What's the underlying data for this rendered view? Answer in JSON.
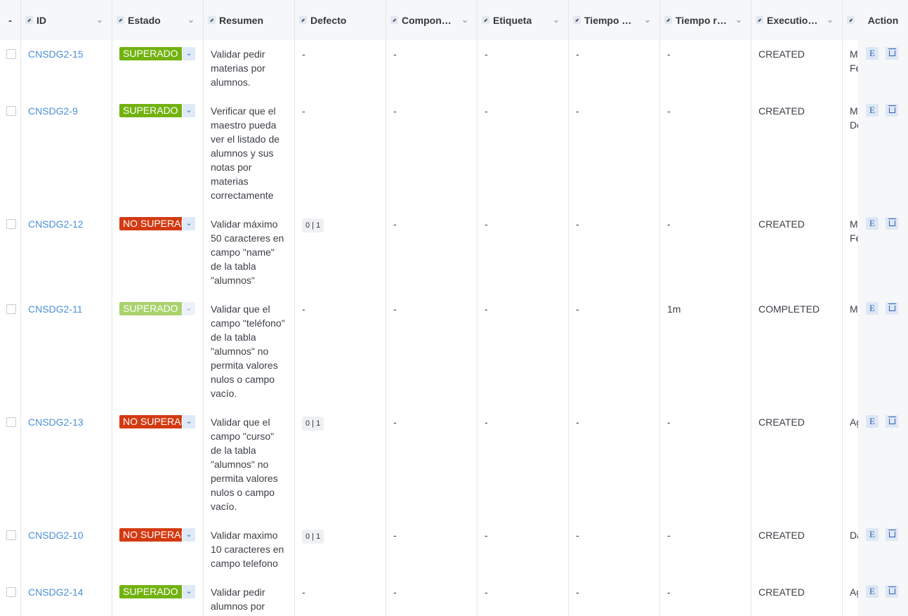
{
  "headers": {
    "select": "-",
    "id": "ID",
    "estado": "Estado",
    "resumen": "Resumen",
    "defecto": "Defecto",
    "componente": "Componente",
    "etiqueta": "Etiqueta",
    "tiempo_estimado": "Tiempo estimado",
    "tiempo_real": "Tiempo real",
    "execution": "Execution status",
    "extra": "",
    "action": "Action"
  },
  "colors": {
    "superado": "#72b20f",
    "superado_faded": "#a9d26c",
    "no_superado": "#d33a12",
    "link": "#4a90d9"
  },
  "rows": [
    {
      "id": "CNSDG2-15",
      "estado": "SUPERADO",
      "estado_kind": "superado",
      "resumen": "Validar pedir materias por alumnos.",
      "defecto": "-",
      "componente": "-",
      "etiqueta": "-",
      "tiempo_estimado": "-",
      "tiempo_real": "-",
      "execution": "CREATED",
      "extra": "M\nFe"
    },
    {
      "id": "CNSDG2-9",
      "estado": "SUPERADO",
      "estado_kind": "superado",
      "resumen": "Verificar que el maestro pueda ver el listado de alumnos y sus notas por materias correctamente",
      "defecto": "-",
      "componente": "-",
      "etiqueta": "-",
      "tiempo_estimado": "-",
      "tiempo_real": "-",
      "execution": "CREATED",
      "extra": "M\nDo"
    },
    {
      "id": "CNSDG2-12",
      "estado": "NO SUPERADO",
      "estado_kind": "no_superado",
      "resumen": "Validar máximo 50 caracteres en campo \"name\" de la tabla \"alumnos\"",
      "defecto": "0 | 1",
      "componente": "-",
      "etiqueta": "-",
      "tiempo_estimado": "-",
      "tiempo_real": "-",
      "execution": "CREATED",
      "extra": "M\nFe"
    },
    {
      "id": "CNSDG2-11",
      "estado": "SUPERADO",
      "estado_kind": "superado_faded",
      "resumen": "Validar que el campo \"teléfono\" de la tabla \"alumnos\" no permita valores nulos o campo vacío.",
      "defecto": "-",
      "componente": "-",
      "etiqueta": "-",
      "tiempo_estimado": "-",
      "tiempo_real": "1m",
      "execution": "COMPLETED",
      "extra": "M"
    },
    {
      "id": "CNSDG2-13",
      "estado": "NO SUPERADO",
      "estado_kind": "no_superado",
      "resumen": "Validar que el campo \"curso\" de la tabla \"alumnos\" no permita valores nulos o campo vacío.",
      "defecto": "0 | 1",
      "componente": "-",
      "etiqueta": "-",
      "tiempo_estimado": "-",
      "tiempo_real": "-",
      "execution": "CREATED",
      "extra": "Ag"
    },
    {
      "id": "CNSDG2-10",
      "estado": "NO SUPERADO",
      "estado_kind": "no_superado",
      "resumen": "Validar maximo 10 caracteres en campo telefono",
      "defecto": "0 | 1",
      "componente": "-",
      "etiqueta": "-",
      "tiempo_estimado": "-",
      "tiempo_real": "-",
      "execution": "CREATED",
      "extra": "Da"
    },
    {
      "id": "CNSDG2-14",
      "estado": "SUPERADO",
      "estado_kind": "superado",
      "resumen": "Validar pedir alumnos por",
      "defecto": "-",
      "componente": "-",
      "etiqueta": "-",
      "tiempo_estimado": "-",
      "tiempo_real": "-",
      "execution": "CREATED",
      "extra": "Ag"
    }
  ],
  "action_buttons": {
    "edit": "E",
    "delete": "delete"
  }
}
